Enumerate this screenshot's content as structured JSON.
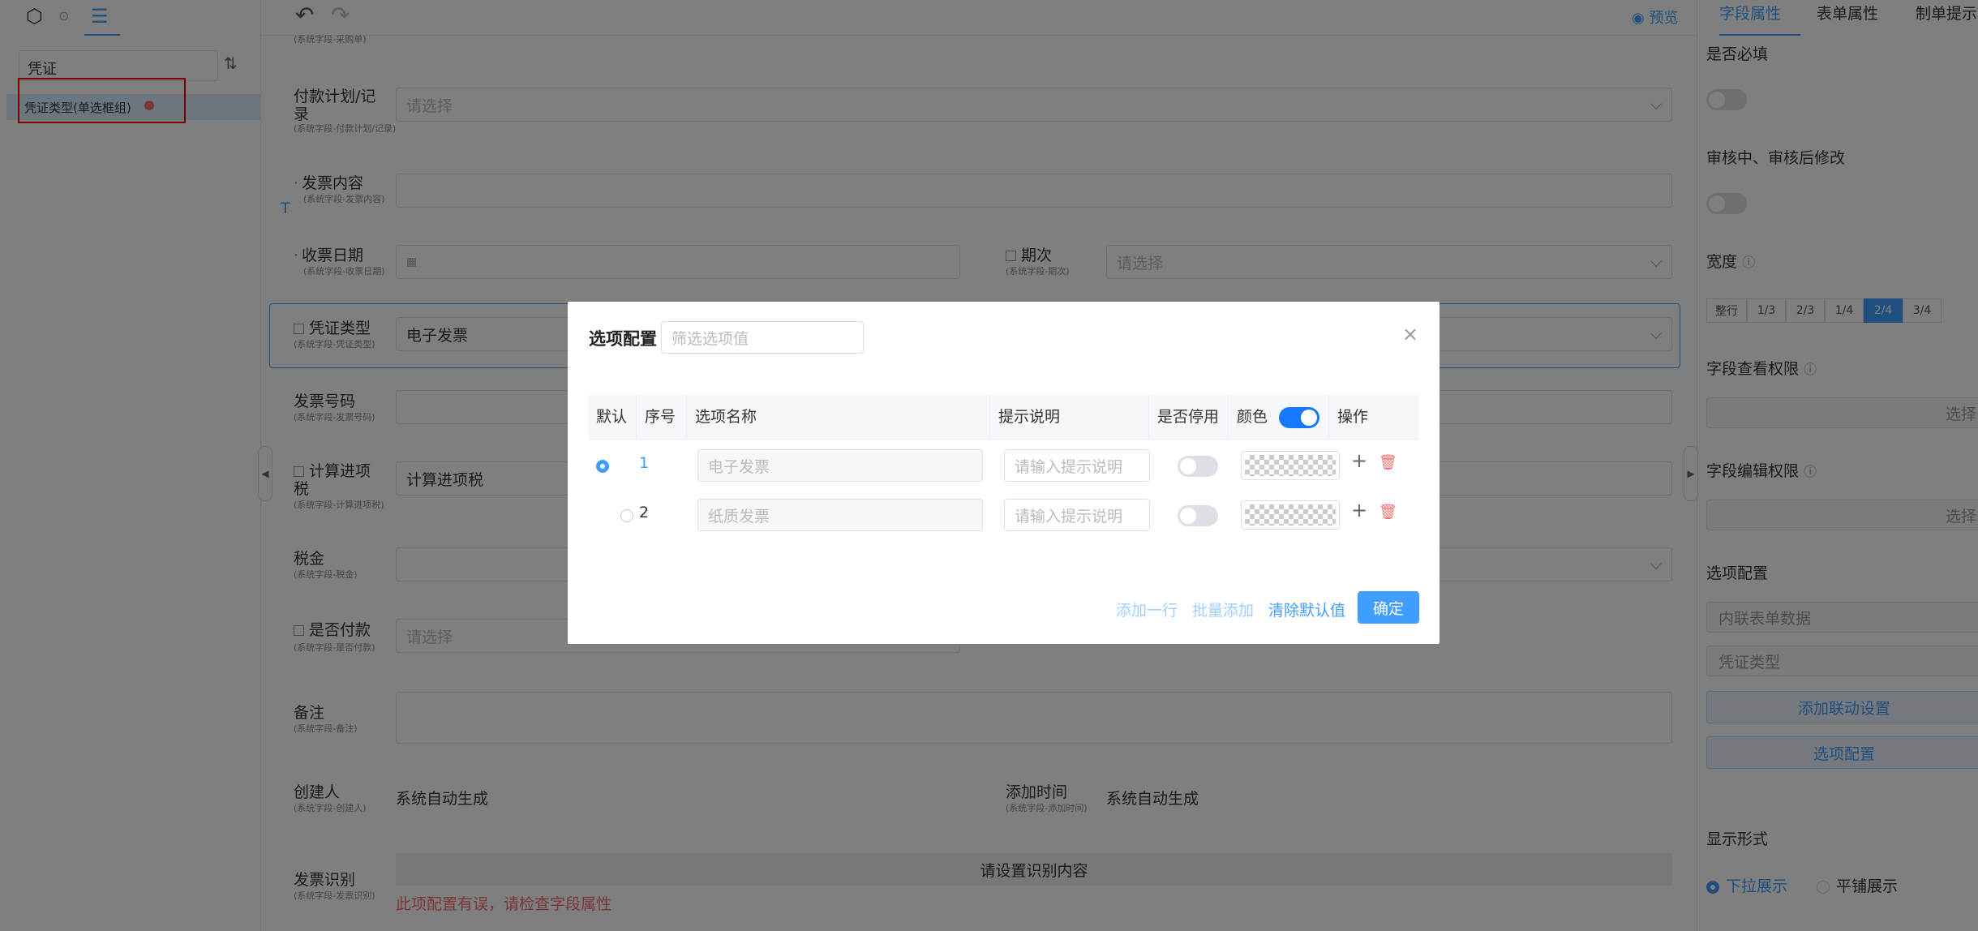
{
  "left": {
    "search_value": "凭证",
    "tree_item": "凭证类型(单选框组)"
  },
  "toolbar": {
    "preview": "预览"
  },
  "form": {
    "payment_plan": {
      "label": "付款计划/记录",
      "sub": "(系统字段-付款计划/记录)",
      "placeholder": "请选择"
    },
    "invoice_content": {
      "label": "发票内容",
      "sub": "(系统字段-发票内容)"
    },
    "receive_date": {
      "label": "收票日期",
      "sub": "(系统字段-收票日期)"
    },
    "period": {
      "label": "期次",
      "sub": "(系统字段-期次)",
      "placeholder": "请选择"
    },
    "voucher_type": {
      "label": "凭证类型",
      "sub": "(系统字段-凭证类型)",
      "value": "电子发票"
    },
    "invoice_no": {
      "label": "发票号码",
      "sub": "(系统字段-发票号码)"
    },
    "tax_calc": {
      "label": "计算进项税",
      "sub": "(系统字段-计算进项税)",
      "value": "计算进项税"
    },
    "tax": {
      "label": "税金",
      "sub": "(系统字段-税金)"
    },
    "paid": {
      "label": "是否付款",
      "sub": "(系统字段-是否付款)",
      "placeholder": "请选择"
    },
    "remark": {
      "label": "备注",
      "sub": "(系统字段-备注)"
    },
    "creator": {
      "label": "创建人",
      "sub": "(系统字段-创建人)",
      "value": "系统自动生成"
    },
    "add_time": {
      "label": "添加时间",
      "sub": "(系统字段-添加时间)",
      "value": "系统自动生成"
    },
    "ocr": {
      "label": "发票识别",
      "sub": "(系统字段-发票识别)",
      "button": "请设置识别内容",
      "error": "此项配置有误，请检查字段属性"
    }
  },
  "right": {
    "tabs": [
      "字段属性",
      "表单属性",
      "制单提示"
    ],
    "required": "是否必填",
    "modify_after_audit": "审核中、审核后修改",
    "width": "宽度",
    "width_options": [
      "整行",
      "1/3",
      "2/3",
      "1/4",
      "2/4",
      "3/4"
    ],
    "width_selected": "2/4",
    "view_perm": "字段查看权限",
    "edit_perm": "字段编辑权限",
    "select_short": "选择",
    "option_config": "选项配置",
    "source": "内联表单数据",
    "source_field": "凭证类型",
    "add_link": "添加联动设置",
    "option_btn": "选项配置",
    "display_mode": "显示形式",
    "display_dropdown": "下拉展示",
    "display_flat": "平铺展示"
  },
  "dialog": {
    "title": "选项配置",
    "filter_placeholder": "筛选选项值",
    "headers": [
      "默认",
      "序号",
      "选项名称",
      "提示说明",
      "是否停用",
      "颜色",
      "操作"
    ],
    "rows": [
      {
        "index": "1",
        "name": "电子发票",
        "hint_placeholder": "请输入提示说明",
        "default": true
      },
      {
        "index": "2",
        "name": "纸质发票",
        "hint_placeholder": "请输入提示说明",
        "default": false
      }
    ],
    "add_row": "添加一行",
    "batch_add": "批量添加",
    "clear_default": "清除默认值",
    "confirm": "确定"
  },
  "colors": {
    "primary": "#409eff",
    "danger": "#f56c6c",
    "switch_on": "#1677ff"
  }
}
